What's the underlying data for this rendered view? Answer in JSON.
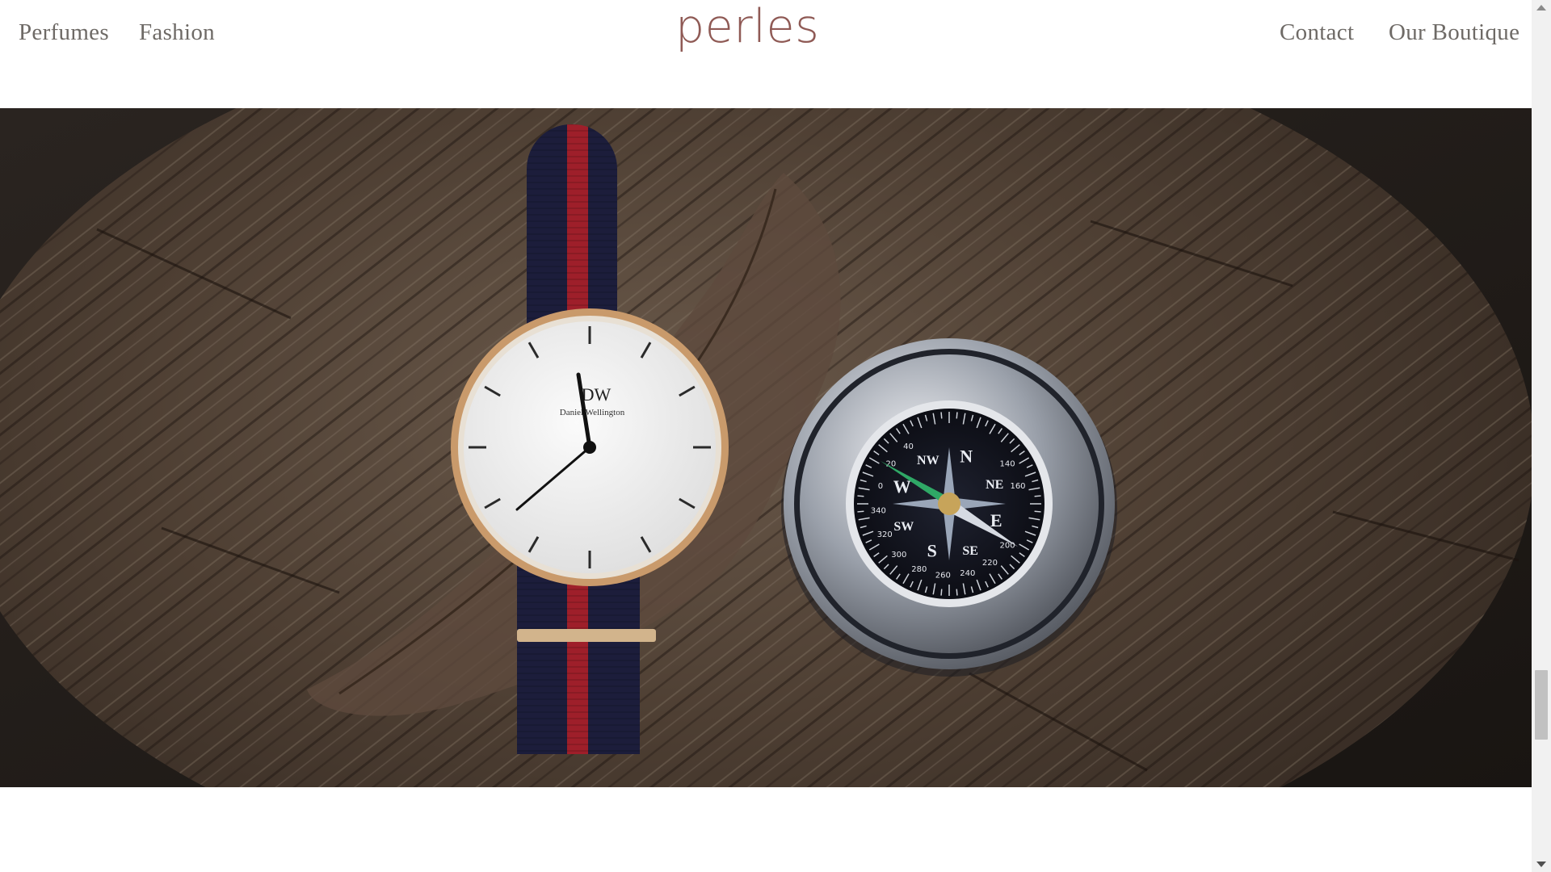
{
  "header": {
    "logo": "perles",
    "nav_left": [
      "Perfumes",
      "Fashion"
    ],
    "nav_right": [
      "Contact",
      "Our Boutique"
    ]
  },
  "hero": {
    "watch_brand_mark": "DW",
    "watch_brand_name": "Daniel Wellington",
    "compass_cardinals": [
      "N",
      "NE",
      "E",
      "SE",
      "S",
      "SW",
      "W",
      "NW"
    ],
    "compass_degrees": [
      "300",
      "320",
      "340",
      "0",
      "20",
      "40",
      "140",
      "160",
      "200",
      "220",
      "240",
      "260",
      "280"
    ]
  },
  "colors": {
    "logo": "#8f5a55",
    "nav_text": "#6e6a66",
    "wood_dark": "#3b2e25",
    "strap_navy": "#1c1d3b",
    "strap_red": "#9e1f2a",
    "watch_case_gold": "#c99a6b"
  }
}
